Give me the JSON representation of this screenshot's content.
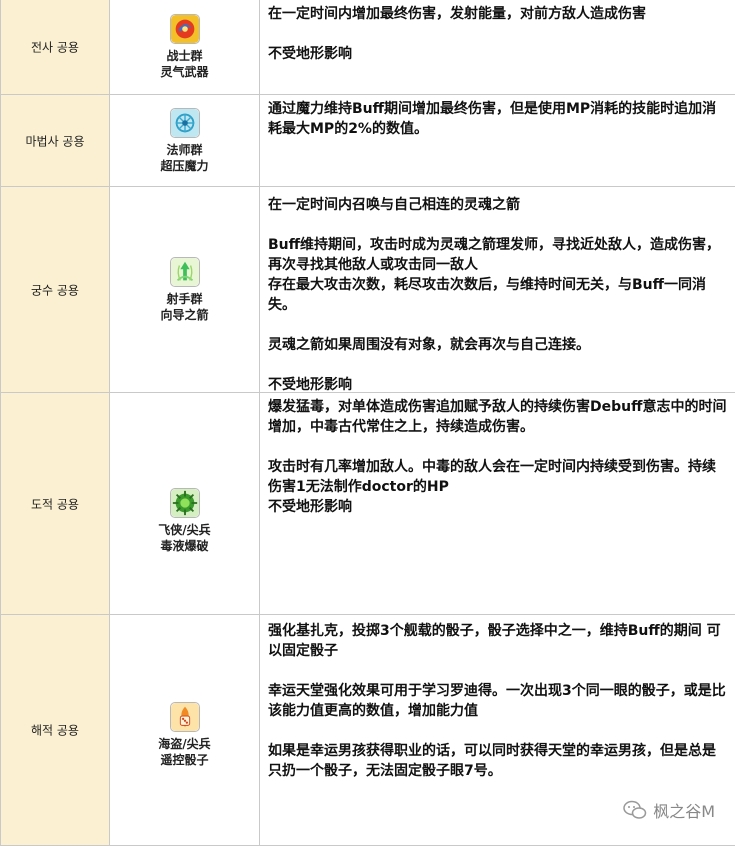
{
  "rows": [
    {
      "job": "전사 공용",
      "skill_line1": "战士群",
      "skill_line2": "灵气武器",
      "icon": "warrior-aura-weapon-icon",
      "desc": [
        "在一定时间内增加最终伤害，发射能量，对前方敌人造成伤害",
        "",
        "不受地形影响"
      ]
    },
    {
      "job": "마법사 공용",
      "skill_line1": "法师群",
      "skill_line2": "超压魔力",
      "icon": "mage-overload-mana-icon",
      "desc": [
        "通过魔力维持Buff期间增加最终伤害，但是使用MP消耗的技能时追加消耗最大MP的2%的数值。"
      ]
    },
    {
      "job": "궁수 공용",
      "skill_line1": "射手群",
      "skill_line2": "向导之箭",
      "icon": "archer-guided-arrow-icon",
      "desc": [
        "在一定时间内召唤与自己相连的灵魂之箭",
        "",
        "Buff维持期间，攻击时成为灵魂之箭理发师，寻找近处敌人，造成伤害，再次寻找其他敌人或攻击同一敌人",
        "存在最大攻击次数，耗尽攻击次数后，与维持时间无关，与Buff一同消失。",
        "",
        "灵魂之箭如果周围没有对象，就会再次与自己连接。",
        "",
        "不受地形影响"
      ]
    },
    {
      "job": "도적 공용",
      "skill_line1": "飞侠/尖兵",
      "skill_line2": "毒液爆破",
      "icon": "thief-venom-burst-icon",
      "desc": [
        "爆发猛毒，对单体造成伤害追加赋予敌人的持续伤害Debuff意志中的时间增加，中毒古代常住之上，持续造成伤害。",
        "",
        "攻击时有几率增加敌人。中毒的敌人会在一定时间内持续受到伤害。持续伤害1无法制作doctor的HP",
        "不受地形影响"
      ]
    },
    {
      "job": "해적 공용",
      "skill_line1": "海盗/尖兵",
      "skill_line2": "遥控骰子",
      "icon": "pirate-loaded-dice-icon",
      "desc": [
        "强化基扎克，投掷3个舰载的骰子，骰子选择中之一，维持Buff的期间 可以固定骰子",
        "",
        "幸运天堂强化效果可用于学习罗迪得。一次出现3个同一眼的骰子，或是比该能力值更高的数值，增加能力值",
        "",
        "如果是幸运男孩获得职业的话，可以同时获得天堂的幸运男孩，但是总是只扔一个骰子，无法固定骰子眼7号。"
      ]
    }
  ],
  "watermark": "枫之谷M"
}
